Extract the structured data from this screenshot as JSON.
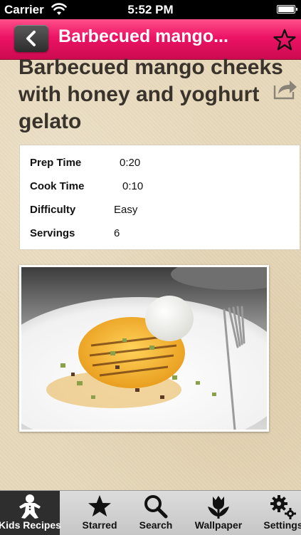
{
  "status_bar": {
    "carrier": "Carrier",
    "time": "5:52 PM"
  },
  "nav": {
    "title": "Barbecued mango...",
    "back_icon": "chevron-left-icon",
    "star_icon": "star-outline-icon"
  },
  "recipe": {
    "title": "Barbecued mango cheeks with honey and yoghurt gelato",
    "info": [
      {
        "label": "Prep Time",
        "value": "0:20"
      },
      {
        "label": "Cook Time",
        "value": "0:10"
      },
      {
        "label": "Difficulty",
        "value": "Easy"
      },
      {
        "label": "Servings",
        "value": "6"
      }
    ]
  },
  "tabs": [
    {
      "label": "Kids Recipes",
      "icon": "gingerbread-man-icon",
      "active": true
    },
    {
      "label": "Starred",
      "icon": "star-icon",
      "active": false
    },
    {
      "label": "Search",
      "icon": "magnifier-icon",
      "active": false
    },
    {
      "label": "Wallpaper",
      "icon": "tulip-icon",
      "active": false
    },
    {
      "label": "Settings",
      "icon": "gears-icon",
      "active": false
    }
  ],
  "colors": {
    "accent": "#ec1365",
    "background": "#e7d9bb",
    "text": "#3a332b"
  }
}
